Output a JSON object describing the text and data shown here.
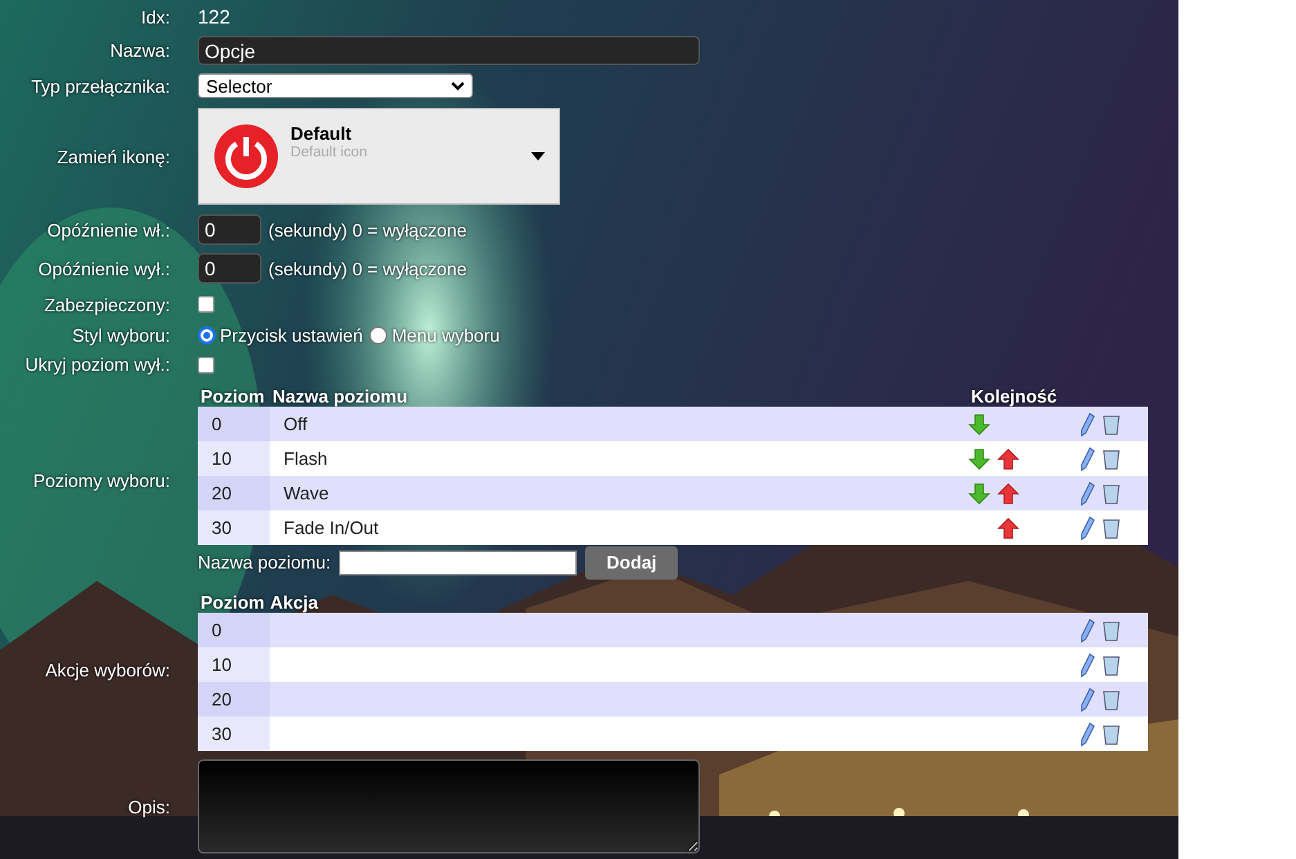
{
  "idx": {
    "label": "Idx:",
    "value": "122"
  },
  "name": {
    "label": "Nazwa:",
    "value": "Opcje"
  },
  "switch_type": {
    "label": "Typ przełącznika:",
    "value": "Selector"
  },
  "icon": {
    "label": "Zamień ikonę:",
    "name": "Default",
    "description": "Default icon"
  },
  "delays": [
    {
      "label": "Opóźnienie wł.:",
      "value": "0",
      "hint": "(sekundy) 0 = wyłączone"
    },
    {
      "label": "Opóźnienie wył.:",
      "value": "0",
      "hint": "(sekundy) 0 = wyłączone"
    }
  ],
  "protected": {
    "label": "Zabezpieczony:",
    "checked": false
  },
  "selector_style": {
    "label": "Styl wyboru:",
    "options": [
      {
        "label": "Przycisk ustawień",
        "selected": true
      },
      {
        "label": "Menu wyboru",
        "selected": false
      }
    ]
  },
  "hide_off": {
    "label": "Ukryj poziom wył.:",
    "checked": false
  },
  "levels": {
    "label": "Poziomy wyboru:",
    "columns": [
      "Poziom",
      "Nazwa poziomu",
      "Kolejność"
    ],
    "rows": [
      {
        "level": "0",
        "name": "Off",
        "move_down": true,
        "move_up": false
      },
      {
        "level": "10",
        "name": "Flash",
        "move_down": true,
        "move_up": true
      },
      {
        "level": "20",
        "name": "Wave",
        "move_down": true,
        "move_up": true
      },
      {
        "level": "30",
        "name": "Fade In/Out",
        "move_down": false,
        "move_up": true
      }
    ],
    "add_label": "Nazwa poziomu:",
    "add_button": "Dodaj"
  },
  "actions": {
    "label": "Akcje wyborów:",
    "columns": [
      "Poziom",
      "Akcja"
    ],
    "rows": [
      {
        "level": "0"
      },
      {
        "level": "10"
      },
      {
        "level": "20"
      },
      {
        "level": "30"
      }
    ]
  },
  "description": {
    "label": "Opis:"
  }
}
